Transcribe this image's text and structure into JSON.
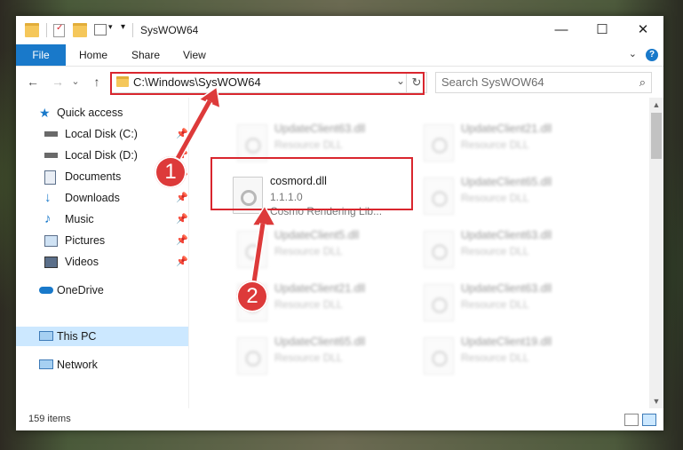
{
  "window": {
    "title": "SysWOW64",
    "minimize_glyph": "—",
    "maximize_glyph": "☐",
    "close_glyph": "✕"
  },
  "ribbon": {
    "tabs": [
      "File",
      "Home",
      "Share",
      "View"
    ],
    "help_glyph": "?"
  },
  "nav": {
    "back_glyph": "←",
    "forward_glyph": "→",
    "recent_glyph": "⌄",
    "up_glyph": "↑",
    "address": "C:\\Windows\\SysWOW64",
    "search_placeholder": "Search SysWOW64"
  },
  "sidebar": {
    "items": [
      {
        "label": "Quick access",
        "icon": "star-icon"
      },
      {
        "label": "Local Disk (C:)",
        "icon": "drive-icon"
      },
      {
        "label": "Local Disk (D:)",
        "icon": "drive-icon"
      },
      {
        "label": "Documents",
        "icon": "documents-icon"
      },
      {
        "label": "Downloads",
        "icon": "download-icon"
      },
      {
        "label": "Music",
        "icon": "music-icon"
      },
      {
        "label": "Pictures",
        "icon": "pictures-icon"
      },
      {
        "label": "Videos",
        "icon": "videos-icon"
      },
      {
        "label": "OneDrive",
        "icon": "cloud-icon"
      },
      {
        "label": "This PC",
        "icon": "computer-icon"
      },
      {
        "label": "Network",
        "icon": "network-icon"
      }
    ]
  },
  "files": {
    "highlighted": {
      "name": "cosmord.dll",
      "version": "1.1.1.0",
      "description": "Cosmo Rendering Lib..."
    },
    "blurred": [
      {
        "name": "UpdateClient63.dll",
        "type": "Resource DLL"
      },
      {
        "name": "UpdateClient21.dll",
        "type": "Resource DLL"
      },
      {
        "name": "UpdateClient65.dll",
        "type": "Resource DLL"
      },
      {
        "name": "UpdateClient5.dll",
        "type": "Resource DLL"
      },
      {
        "name": "UpdateClient63.dll",
        "type": "Resource DLL"
      },
      {
        "name": "UpdateClient21.dll",
        "type": "Resource DLL"
      },
      {
        "name": "UpdateClient63.dll",
        "type": "Resource DLL"
      },
      {
        "name": "UpdateClient65.dll",
        "type": "Resource DLL"
      },
      {
        "name": "UpdateClient19.dll",
        "type": "Resource DLL"
      }
    ]
  },
  "status": {
    "item_count": "159 items"
  },
  "annotations": {
    "step1": "1",
    "step2": "2",
    "color": "#dd3a3a"
  },
  "colors": {
    "accent": "#1979ca",
    "selection": "#cce8ff"
  }
}
